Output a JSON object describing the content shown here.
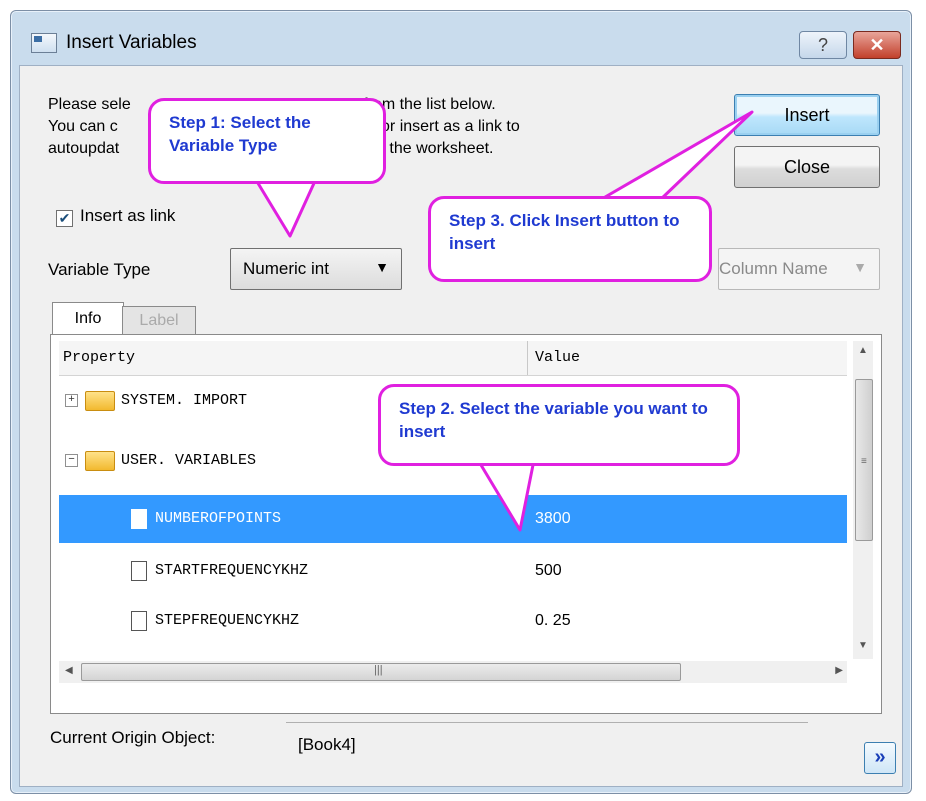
{
  "window": {
    "title": "Insert Variables",
    "help_label": "?",
    "close_label": "✕"
  },
  "description": {
    "line1_a": "Please sele",
    "line1_b": "s from the list below.",
    "line2_a": "You can c",
    "line2_b": "xt, or insert as a link to",
    "line3_a": "autoupdat",
    "line3_b": "l into the worksheet."
  },
  "buttons": {
    "insert": "Insert",
    "close": "Close",
    "expand": "»"
  },
  "options": {
    "insert_as_link_label": "Insert as link",
    "insert_as_link_checked": "✔",
    "variable_type_label": "Variable Type",
    "variable_type_value": "Numeric int",
    "column_name_value": "Column Name"
  },
  "tabs": [
    "Info",
    "Label"
  ],
  "grid": {
    "col_property": "Property",
    "col_value": "Value",
    "rows": [
      {
        "name": "SYSTEM. IMPORT",
        "value": "",
        "type": "folder",
        "expander": "+"
      },
      {
        "name": "USER. VARIABLES",
        "value": "",
        "type": "folder",
        "expander": "−"
      },
      {
        "name": "NUMBEROFPOINTS",
        "value": "3800",
        "type": "item",
        "selected": true
      },
      {
        "name": "STARTFREQUENCYKHZ",
        "value": "500",
        "type": "item"
      },
      {
        "name": "STEPFREQUENCYKHZ",
        "value": "0. 25",
        "type": "item"
      }
    ]
  },
  "origin": {
    "label": "Current Origin Object:",
    "value": "[Book4]"
  },
  "callouts": {
    "step1": "Step 1: Select the Variable  Type",
    "step2": "Step 2. Select the variable you want to insert",
    "step3": "Step 3. Click Insert button to insert"
  },
  "colors": {
    "callout_border": "#e020e0",
    "callout_text": "#1f3ad1",
    "selection": "#3399ff"
  }
}
